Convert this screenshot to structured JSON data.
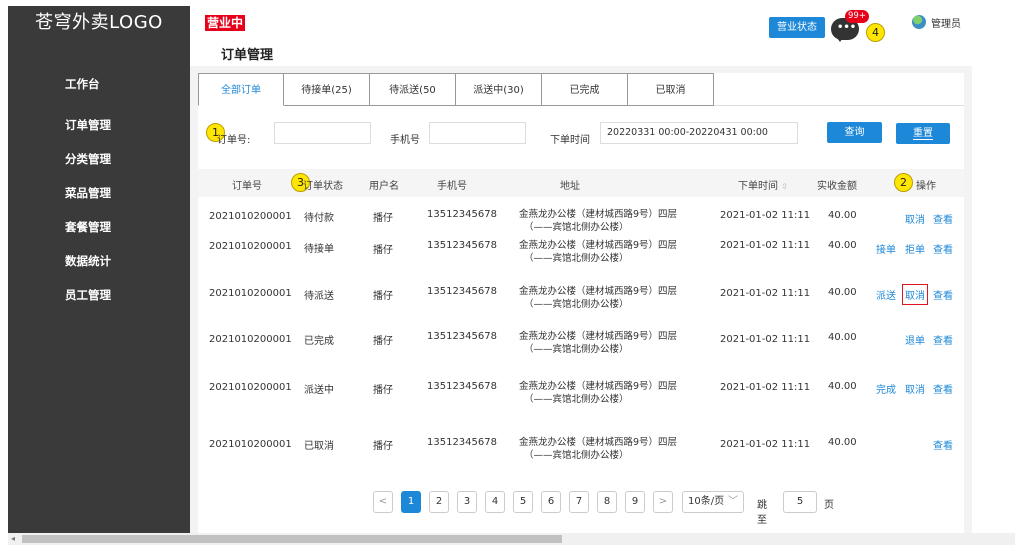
{
  "sidebar": {
    "logo": "苍穹外卖LOGO",
    "items": [
      {
        "label": "工作台"
      },
      {
        "label": "订单管理"
      },
      {
        "label": "分类管理"
      },
      {
        "label": "菜品管理"
      },
      {
        "label": "套餐管理"
      },
      {
        "label": "数据统计"
      },
      {
        "label": "员工管理"
      }
    ]
  },
  "header": {
    "status_tag": "营业中",
    "page_title": "订单管理",
    "shop_status_button": "营业状态",
    "message_badge": "99+",
    "admin_name": "管理员"
  },
  "annotations": [
    "1",
    "2",
    "3",
    "4"
  ],
  "tabs": [
    {
      "label": "全部订单"
    },
    {
      "label": "待接单(25)"
    },
    {
      "label": "待派送(50"
    },
    {
      "label": "派送中(30)"
    },
    {
      "label": "已完成"
    },
    {
      "label": "已取消"
    }
  ],
  "filter": {
    "order_no_label": "订单号:",
    "order_no_value": "",
    "phone_label": "手机号",
    "phone_value": "",
    "time_label": "下单时间",
    "time_value": "20220331 00:00-20220431 00:00",
    "query_button": "查询",
    "reset_button": "重置"
  },
  "table": {
    "headers": {
      "order_no": "订单号",
      "status": "订单状态",
      "username": "用户名",
      "phone": "手机号",
      "address": "地址",
      "order_time": "下单时间",
      "amount": "实收金额",
      "actions": "操作"
    },
    "rows": [
      {
        "order_no": "2021010200001",
        "status": "待付款",
        "username": "播仔",
        "phone": "13512345678",
        "address_line1": "金燕龙办公楼（建材城西路9号）四层",
        "address_line2": "（——宾馆北侧办公楼）",
        "order_time": "2021-01-02 11:11",
        "amount": "40.00",
        "actions": [
          "取消",
          "查看"
        ]
      },
      {
        "order_no": "2021010200001",
        "status": "待接单",
        "username": "播仔",
        "phone": "13512345678",
        "address_line1": "金燕龙办公楼（建材城西路9号）四层",
        "address_line2": "（——宾馆北侧办公楼）",
        "order_time": "2021-01-02 11:11",
        "amount": "40.00",
        "actions": [
          "接单",
          "拒单",
          "查看"
        ]
      },
      {
        "order_no": "2021010200001",
        "status": "待派送",
        "username": "播仔",
        "phone": "13512345678",
        "address_line1": "金燕龙办公楼（建材城西路9号）四层",
        "address_line2": "（——宾馆北侧办公楼）",
        "order_time": "2021-01-02 11:11",
        "amount": "40.00",
        "actions": [
          "派送",
          "取消",
          "查看"
        ]
      },
      {
        "order_no": "2021010200001",
        "status": "已完成",
        "username": "播仔",
        "phone": "13512345678",
        "address_line1": "金燕龙办公楼（建材城西路9号）四层",
        "address_line2": "（——宾馆北侧办公楼）",
        "order_time": "2021-01-02 11:11",
        "amount": "40.00",
        "actions": [
          "退单",
          "查看"
        ]
      },
      {
        "order_no": "2021010200001",
        "status": "派送中",
        "username": "播仔",
        "phone": "13512345678",
        "address_line1": "金燕龙办公楼（建材城西路9号）四层",
        "address_line2": "（——宾馆北侧办公楼）",
        "order_time": "2021-01-02 11:11",
        "amount": "40.00",
        "actions": [
          "完成",
          "取消",
          "查看"
        ]
      },
      {
        "order_no": "2021010200001",
        "status": "已取消",
        "username": "播仔",
        "phone": "13512345678",
        "address_line1": "金燕龙办公楼（建材城西路9号）四层",
        "address_line2": "（——宾馆北侧办公楼）",
        "order_time": "2021-01-02 11:11",
        "amount": "40.00",
        "actions": [
          "查看"
        ]
      }
    ]
  },
  "pagination": {
    "prev": "<",
    "next": ">",
    "pages": [
      "1",
      "2",
      "3",
      "4",
      "5",
      "6",
      "7",
      "8",
      "9"
    ],
    "current": "1",
    "page_size": "10条/页",
    "jump_label": "跳至",
    "jump_value": "5",
    "page_suffix": "页"
  },
  "colors": {
    "accent": "#1e88d8",
    "sidebar_bg": "#3a3a3a",
    "status_red": "#e6001a",
    "annotation_yellow": "#ffe600",
    "highlight_border": "#e0141e"
  }
}
